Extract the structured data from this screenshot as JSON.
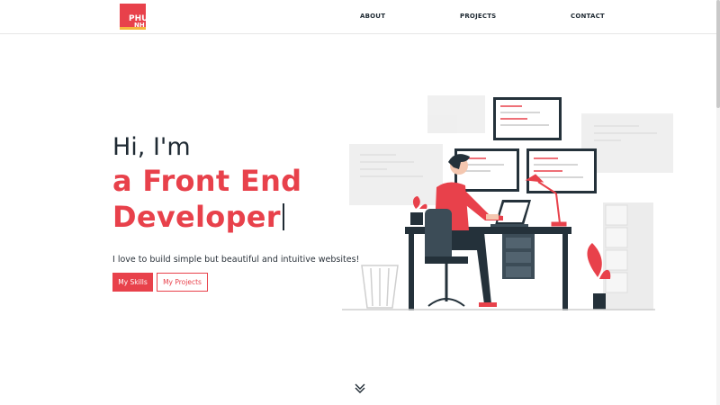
{
  "logo": {
    "line1": "PHU",
    "line2": "NH"
  },
  "nav": {
    "about": "ABOUT",
    "projects": "PROJECTS",
    "contact": "CONTACT"
  },
  "hero": {
    "greeting": "Hi, I'm",
    "role_line1": "a Front End",
    "role_line2": "Developer",
    "tagline": "I love to build simple but beautiful and intuitive websites!",
    "primary_button": "My Skills",
    "secondary_button": "My Projects"
  },
  "icons": {
    "scroll_down": "double-chevron-down-icon",
    "illustration": "developer-at-desk-illustration"
  },
  "colors": {
    "accent": "#e8414b",
    "logo_stripe": "#f5b53d",
    "text_dark": "#1f2a33",
    "desk": "#24313a"
  }
}
